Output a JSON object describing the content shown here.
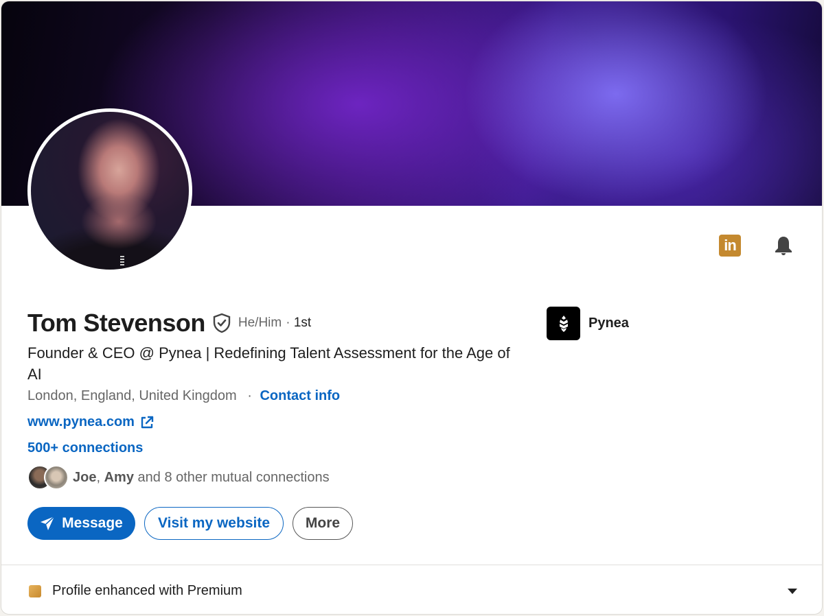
{
  "profile": {
    "name": "Tom Stevenson",
    "pronouns": "He/Him",
    "degree_separator": "·",
    "degree": "1st",
    "headline": "Founder & CEO @ Pynea | Redefining Talent Assessment for the Age of AI",
    "location": "London, England, United Kingdom",
    "location_separator": "·",
    "contact_info_label": "Contact info",
    "website": "www.pynea.com",
    "connections": "500+ connections",
    "mutual": {
      "name1": "Joe",
      "separator": ",",
      "name2": "Amy",
      "rest": "and 8 other mutual connections"
    }
  },
  "actions": {
    "message_label": "Message",
    "visit_website_label": "Visit my website",
    "more_label": "More"
  },
  "company": {
    "name": "Pynea"
  },
  "premium": {
    "label": "Profile enhanced with Premium"
  },
  "icons": {
    "linkedin": "linkedin-icon",
    "bell": "bell-icon",
    "verified": "verified-shield-icon",
    "external_link": "external-link-icon",
    "send": "send-icon",
    "caret": "caret-down-icon",
    "premium": "premium-icon"
  },
  "colors": {
    "accent": "#0a66c2",
    "premium_gold": "#c4892f",
    "text_secondary": "#666666"
  }
}
